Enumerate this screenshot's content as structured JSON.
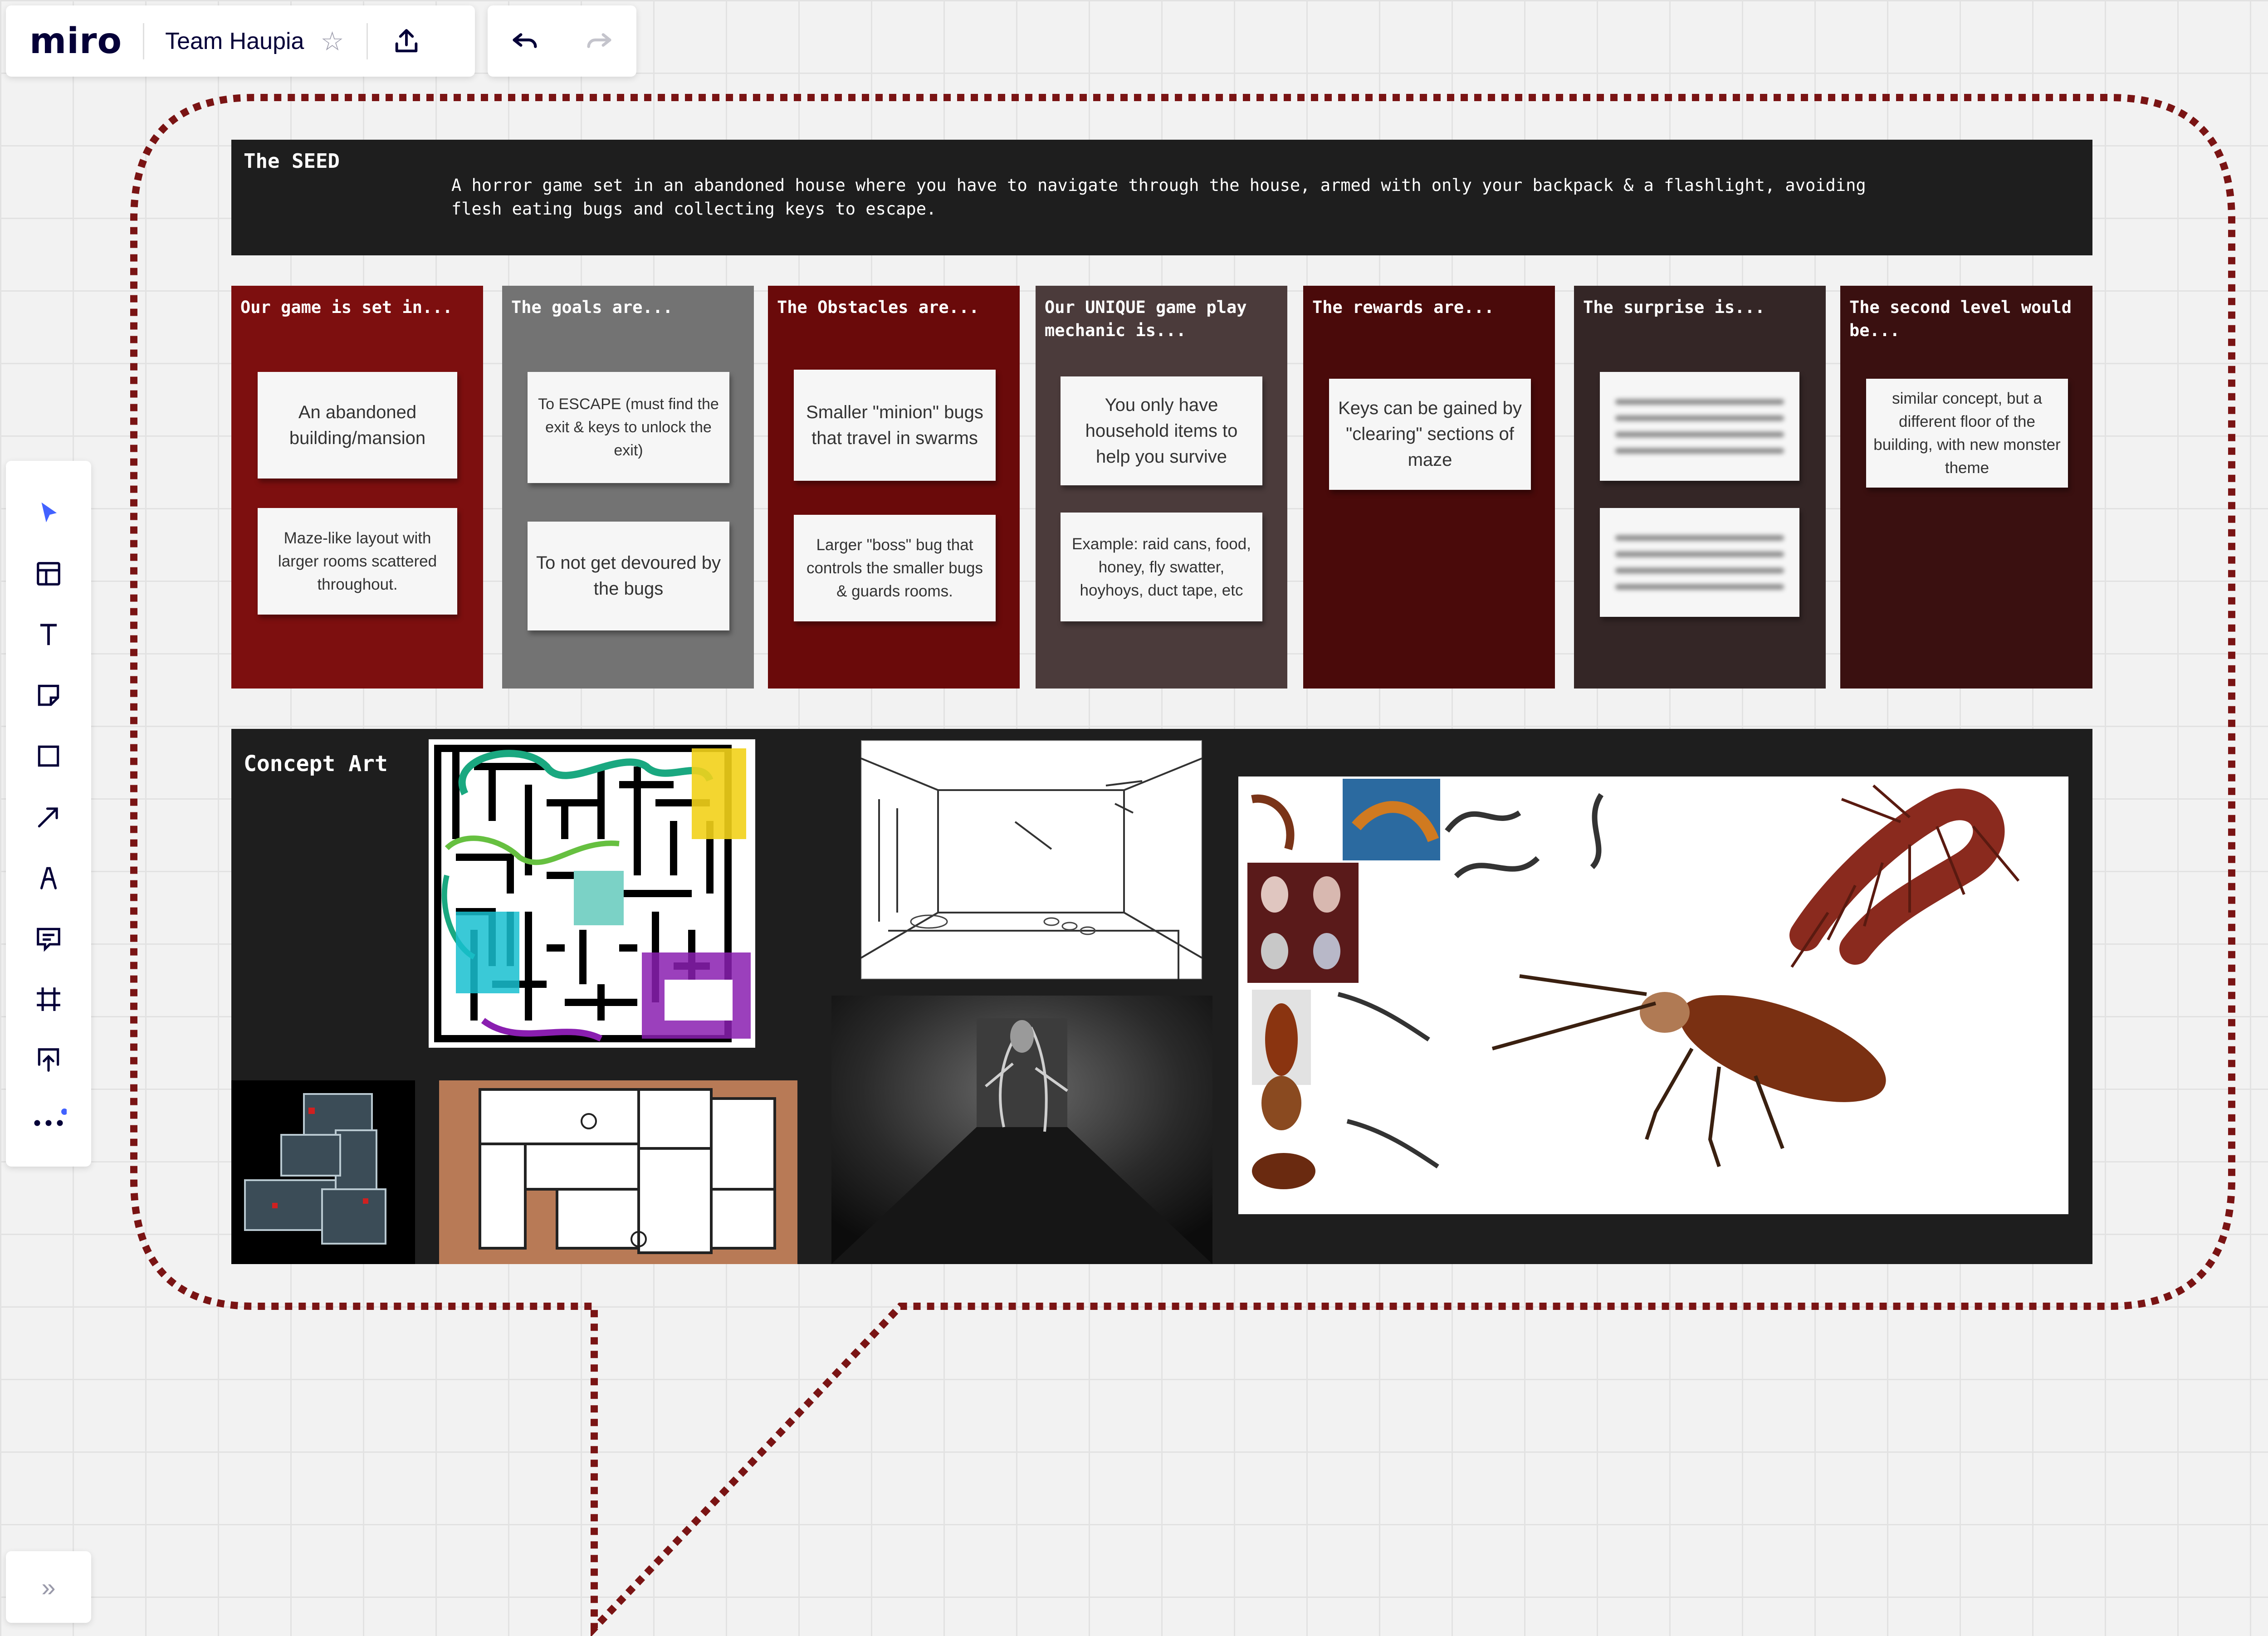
{
  "app": {
    "logo": "miro",
    "board_name": "Team Haupia"
  },
  "toolbar_icons": {
    "star": "star-icon",
    "share": "upload-icon",
    "undo": "undo-icon",
    "redo": "redo-icon"
  },
  "left_tools": [
    {
      "name": "select-tool",
      "icon": "cursor-icon"
    },
    {
      "name": "templates-tool",
      "icon": "templates-icon"
    },
    {
      "name": "text-tool",
      "icon": "text-icon"
    },
    {
      "name": "sticky-note-tool",
      "icon": "sticky-note-icon"
    },
    {
      "name": "shape-tool",
      "icon": "square-icon"
    },
    {
      "name": "connection-line-tool",
      "icon": "arrow-icon"
    },
    {
      "name": "pen-tool",
      "icon": "pen-icon"
    },
    {
      "name": "comment-tool",
      "icon": "comment-icon"
    },
    {
      "name": "frame-tool",
      "icon": "frame-icon"
    },
    {
      "name": "upload-tool",
      "icon": "upload-icon"
    },
    {
      "name": "more-tools",
      "icon": "more-icon"
    }
  ],
  "collapse_label": "»",
  "colors": {
    "accent": "#4262ff",
    "speech_bubble_dots": "#7a1414",
    "col1": "#7d0f0f",
    "col2": "#737373",
    "col3": "#6a0a0a",
    "col4": "#4b3b3b",
    "col5": "#4a0a0a",
    "col6": "#342626",
    "col7": "#3a1010"
  },
  "seed": {
    "title": "The SEED",
    "text": "A horror game set in an abandoned house where you have to navigate through the house, armed with only your backpack & a flashlight, avoiding flesh eating bugs and collecting keys to escape."
  },
  "columns": [
    {
      "title": "Our game is set in...",
      "notes": [
        "An abandoned building/mansion",
        "Maze-like layout with larger rooms scattered throughout."
      ]
    },
    {
      "title": "The goals are...",
      "notes": [
        "To ESCAPE (must find the exit & keys to unlock the exit)",
        "To not get devoured by the bugs"
      ]
    },
    {
      "title": "The Obstacles are...",
      "notes": [
        "Smaller \"minion\" bugs that travel in swarms",
        "Larger \"boss\" bug that controls the smaller bugs & guards rooms."
      ]
    },
    {
      "title": "Our UNIQUE game play mechanic is...",
      "notes": [
        "You only have household items to help you survive",
        "Example: raid cans, food, honey, fly swatter, hoyhoys, duct tape, etc"
      ]
    },
    {
      "title": "The rewards are...",
      "notes": [
        "Keys can be gained by \"clearing\" sections of maze"
      ]
    },
    {
      "title": "The surprise is...",
      "notes": []
    },
    {
      "title": "The second level would be...",
      "notes": [
        "similar concept, but a different floor of the building, with new monster theme"
      ]
    }
  ],
  "concept": {
    "title": "Concept Art",
    "images": [
      {
        "name": "maze-sketch-image"
      },
      {
        "name": "room-sketch-image"
      },
      {
        "name": "dark-hallway-image"
      },
      {
        "name": "bug-reference-collage-image"
      },
      {
        "name": "floor-plan-blueprint-image"
      },
      {
        "name": "floor-plan-colored-image"
      }
    ]
  }
}
